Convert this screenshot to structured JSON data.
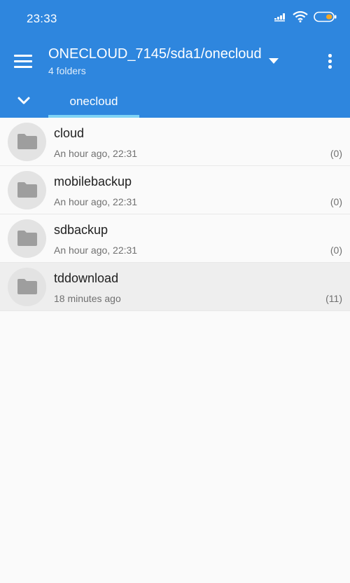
{
  "status_bar": {
    "time": "23:33",
    "icons": [
      "signal-icon",
      "wifi-icon",
      "battery-icon"
    ],
    "battery_color": "#f5a623"
  },
  "app_bar": {
    "title": "ONECLOUD_7145/sda1/onecloud",
    "subtitle": "4 folders",
    "color": "#2e86de",
    "tab": "onecloud",
    "tab_indicator_color": "#7fd3f5"
  },
  "folders": [
    {
      "name": "cloud",
      "modified": "An hour ago, 22:31",
      "count": "(0)",
      "selected": false
    },
    {
      "name": "mobilebackup",
      "modified": "An hour ago, 22:31",
      "count": "(0)",
      "selected": false
    },
    {
      "name": "sdbackup",
      "modified": "An hour ago, 22:31",
      "count": "(0)",
      "selected": false
    },
    {
      "name": "tddownload",
      "modified": "18 minutes ago",
      "count": "(11)",
      "selected": true
    }
  ]
}
